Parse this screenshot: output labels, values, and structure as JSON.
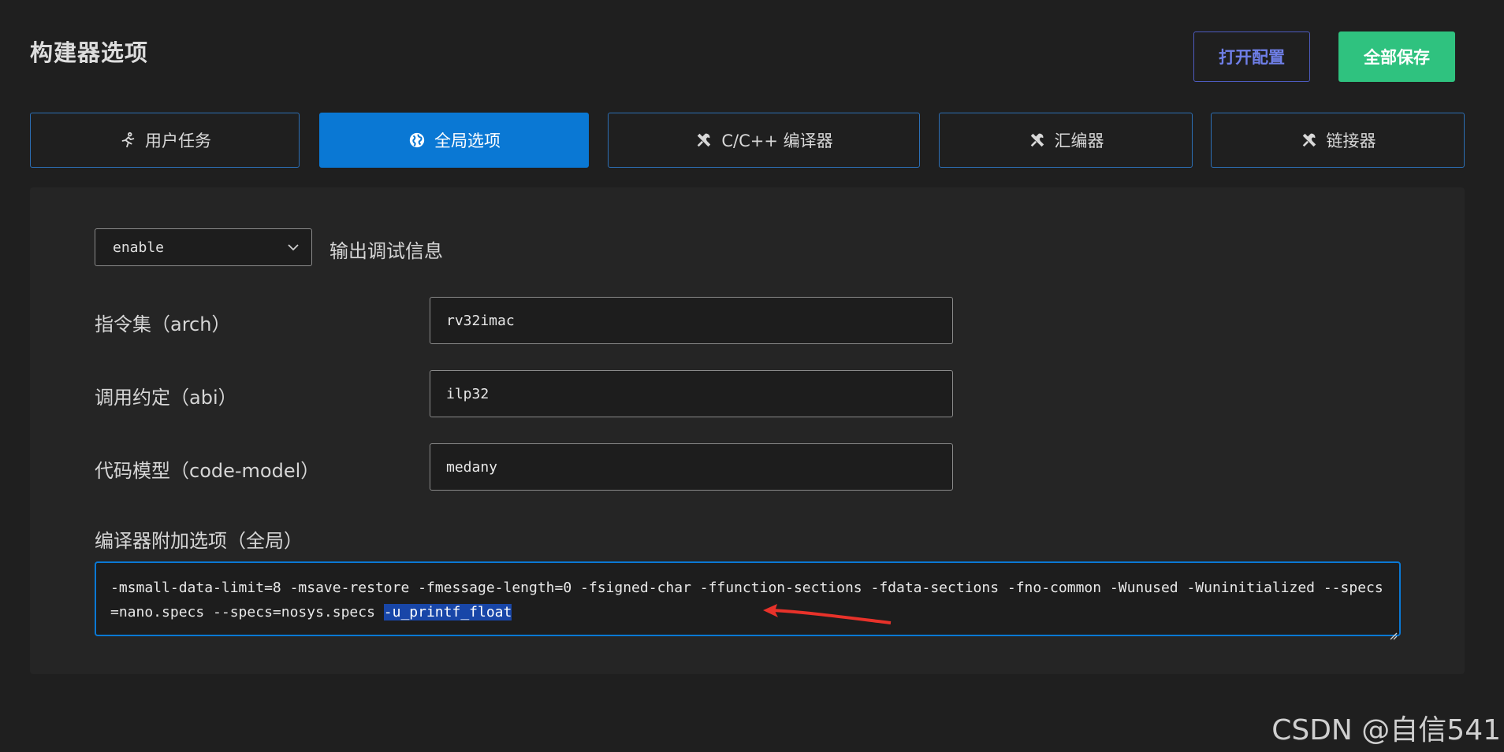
{
  "header": {
    "title": "构建器选项",
    "open_config_label": "打开配置",
    "save_all_label": "全部保存"
  },
  "tabs": [
    {
      "label": "用户任务",
      "icon": "run-icon",
      "active": false
    },
    {
      "label": "全局选项",
      "icon": "globe-icon",
      "active": true
    },
    {
      "label": "C/C++ 编译器",
      "icon": "tools-icon",
      "active": false
    },
    {
      "label": "汇编器",
      "icon": "tools-icon",
      "active": false
    },
    {
      "label": "链接器",
      "icon": "tools-icon",
      "active": false
    }
  ],
  "debug": {
    "selected": "enable",
    "label": "输出调试信息"
  },
  "fields": {
    "arch": {
      "label": "指令集（arch）",
      "value": "rv32imac"
    },
    "abi": {
      "label": "调用约定（abi）",
      "value": "ilp32"
    },
    "code_model": {
      "label": "代码模型（code-model）",
      "value": "medany"
    }
  },
  "extra_options": {
    "label": "编译器附加选项（全局）",
    "value_main": "-msmall-data-limit=8 -msave-restore -fmessage-length=0 -fsigned-char -ffunction-sections -fdata-sections -fno-common -Wunused -Wuninitialized --specs=nano.specs --specs=nosys.specs ",
    "value_selected": "-u_printf_float"
  },
  "watermark": "CSDN @自信541",
  "colors": {
    "accent": "#0a78d4",
    "save": "#2fc27f",
    "open_border": "#4d5bbf",
    "annotation_arrow": "#e8322a"
  }
}
